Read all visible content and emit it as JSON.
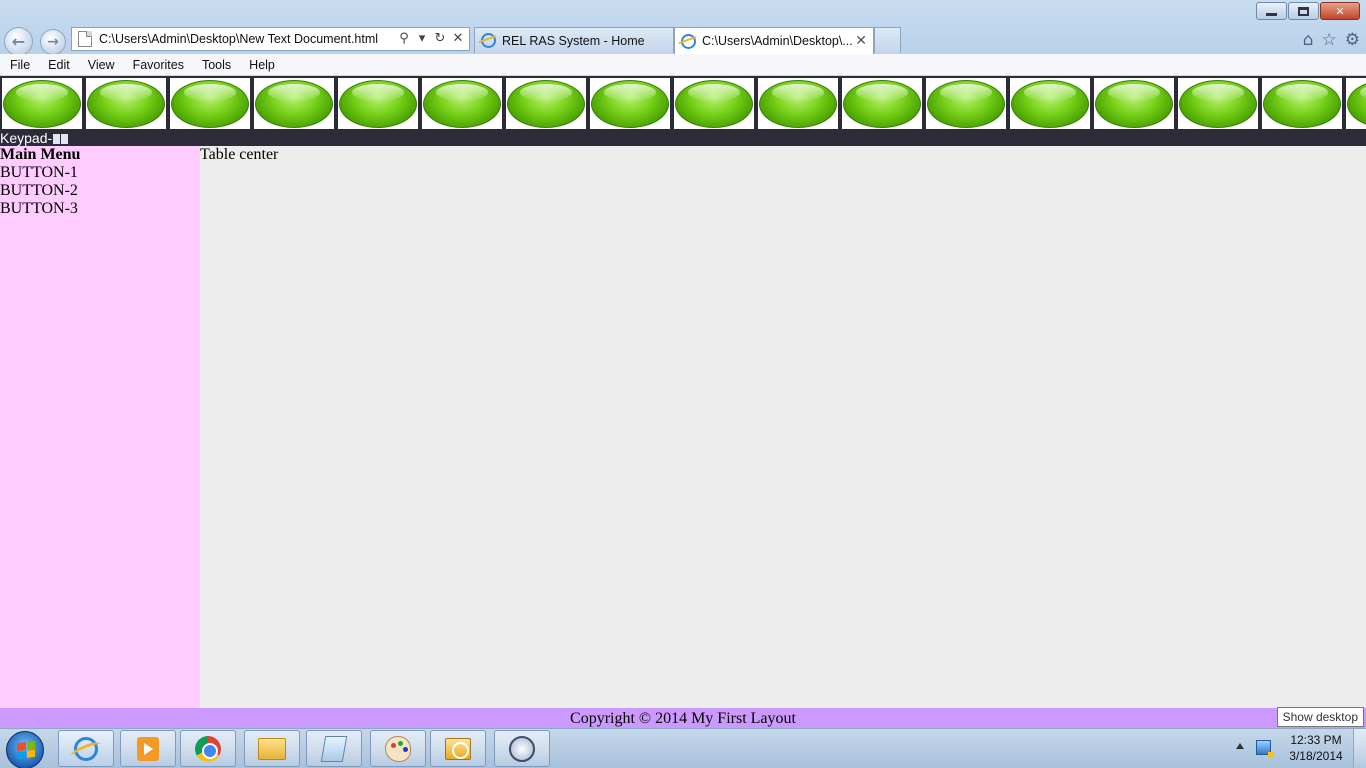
{
  "browser": {
    "address_url": "C:\\Users\\Admin\\Desktop\\New Text Document.html",
    "tabs": [
      {
        "label": "REL RAS System - Home"
      },
      {
        "label": "C:\\Users\\Admin\\Desktop\\..."
      }
    ],
    "menu": [
      "File",
      "Edit",
      "View",
      "Favorites",
      "Tools",
      "Help"
    ]
  },
  "page": {
    "keypad_label": "Keypad-",
    "sidebar": {
      "title": "Main Menu",
      "items": [
        "BUTTON-1",
        "BUTTON-2",
        "BUTTON-3"
      ]
    },
    "main_text": "Table center",
    "footer": "Copyright © 2014 My First Layout"
  },
  "tooltip": "Show desktop",
  "taskbar": {
    "time": "12:33 PM",
    "date": "3/18/2014",
    "apps": [
      "internet-explorer",
      "media-player",
      "chrome",
      "file-explorer",
      "notepad",
      "paint",
      "outlook",
      "virtualbox"
    ]
  },
  "colors": {
    "sidebar_bg": "#ffccff",
    "footer_bg": "#cc99ff",
    "banner_bg": "#2b2b3a",
    "oval_green": "#5fb800"
  }
}
